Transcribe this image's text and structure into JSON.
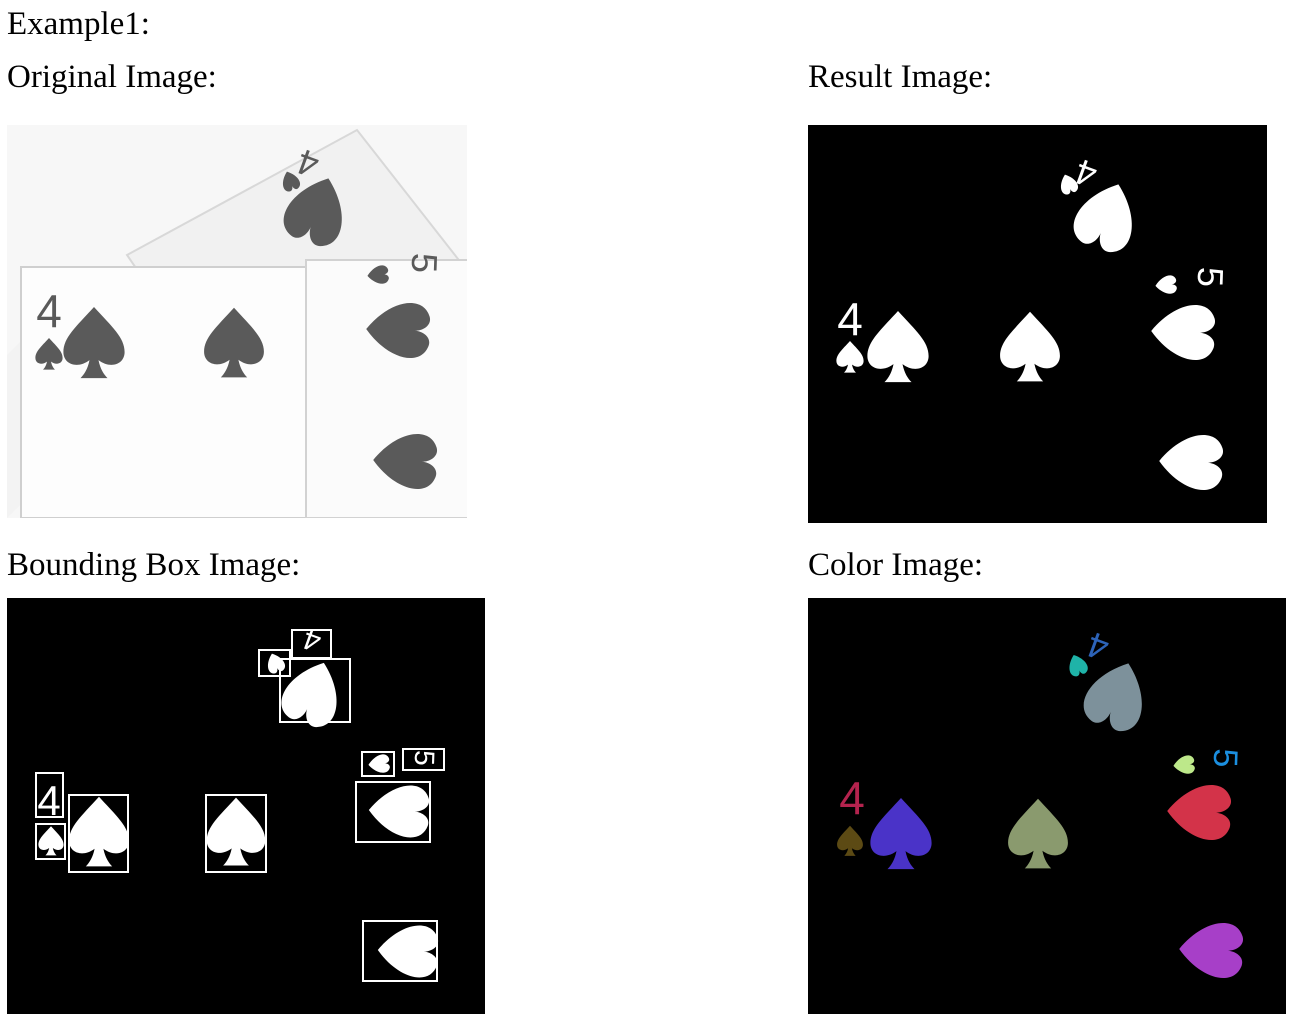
{
  "doc": {
    "heading": "Example1:",
    "panels": [
      {
        "label": "Original Image:"
      },
      {
        "label": "Result Image:"
      },
      {
        "label": "Bounding Box Image:"
      },
      {
        "label": "Color Image:"
      }
    ]
  },
  "glyphs": {
    "four": "4",
    "five": "5"
  },
  "colors": {
    "original_fg": "#5a5a5a",
    "binary_bg": "#000000",
    "binary_fg": "#ffffff",
    "component_top_four": "#2d63b8",
    "component_top_small_heart": "#1fb3a8",
    "component_top_large_heart": "#7d919b",
    "component_five": "#1b8fe0",
    "component_small_heart_right": "#bde88a",
    "component_mid_heart_right": "#d33349",
    "component_four_left": "#b4234e",
    "component_small_spade": "#5c4a14",
    "component_spade_left": "#4a33c8",
    "component_spade_middle": "#8a9a6e",
    "component_bottom_heart": "#a73fc8"
  }
}
